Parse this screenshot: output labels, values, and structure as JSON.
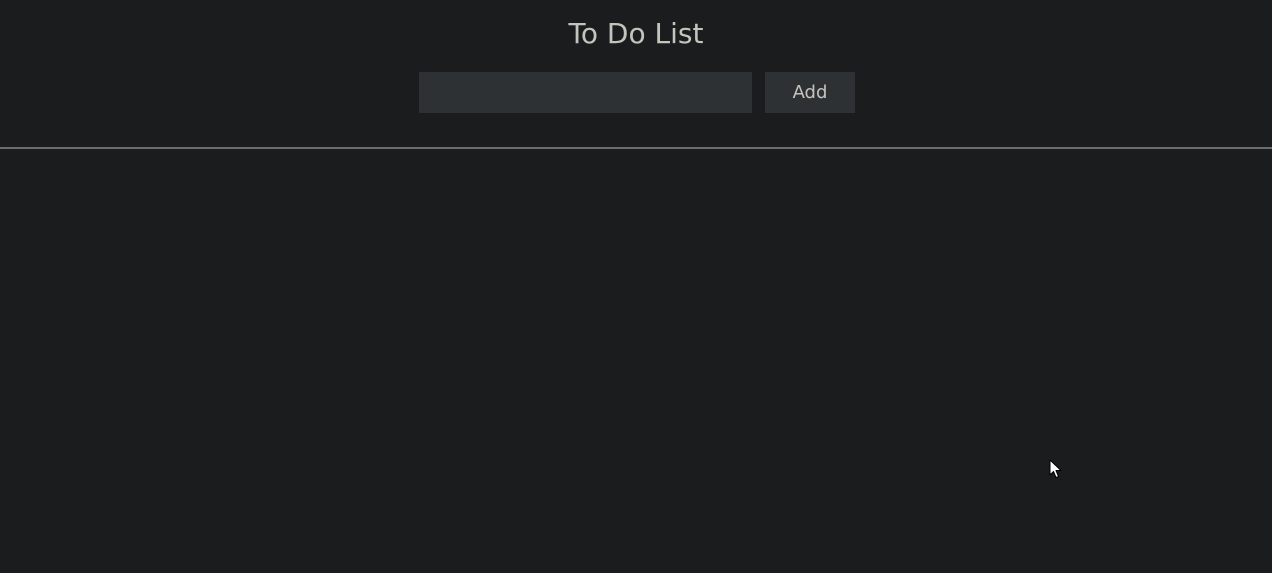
{
  "header": {
    "title": "To Do List"
  },
  "form": {
    "input_value": "",
    "input_placeholder": "",
    "add_label": "Add"
  },
  "list": {
    "items": []
  },
  "cursor": {
    "icon": "mouse-pointer-icon"
  },
  "colors": {
    "background": "#1b1c1e",
    "surface": "#2e3134",
    "text": "#c4c4bc",
    "divider": "#6c6d6e"
  }
}
